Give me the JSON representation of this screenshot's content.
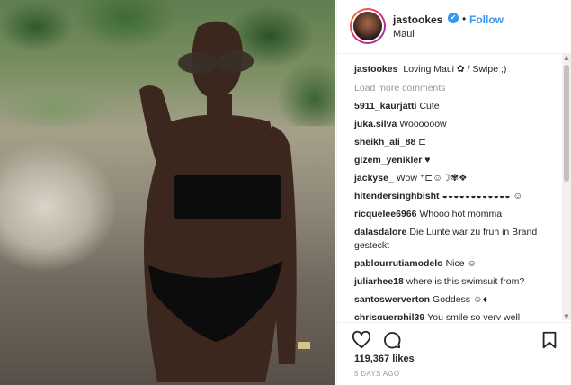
{
  "post": {
    "username": "jastookes",
    "verified_glyph": "✔",
    "separator": "•",
    "follow_label": "Follow",
    "location": "Maui"
  },
  "caption": {
    "username": "jastookes",
    "text": "Loving Maui ✿ / Swipe ;)"
  },
  "load_more": "Load more comments",
  "comments": [
    {
      "username": "5911_kaurjatti",
      "text": "Cute"
    },
    {
      "username": "juka.silva",
      "text": "Woooooow"
    },
    {
      "username": "sheikh_ali_88",
      "text": "⊏"
    },
    {
      "username": "gizem_yenikler",
      "text": "♥"
    },
    {
      "username": "jackyse_",
      "text": "Wow ⁺⊏☺☽✾❖"
    },
    {
      "username": "hitendersinghbisht",
      "text": "◒◒◒◒◒◒◒◒◒◒◒◒ ☺"
    },
    {
      "username": "ricquelee6966",
      "text": "Whooo hot momma"
    },
    {
      "username": "dalasdalore",
      "text": "Die Lunte war zu fruh in Brand gesteckt"
    },
    {
      "username": "pablourrutiamodelo",
      "text": "Nice ☺"
    },
    {
      "username": "juliarhee18",
      "text": "where is this swimsuit from?"
    },
    {
      "username": "santoswerverton",
      "text": "Goddess ☺♦"
    },
    {
      "username": "chrisguerphil39",
      "text": "You smile so very well"
    }
  ],
  "scrollbar": {
    "up": "▲",
    "down": "▼"
  },
  "likes": "119,367 likes",
  "timestamp": "5 DAYS AGO",
  "icons": [
    "heart-icon",
    "comment-icon",
    "bookmark-icon",
    "verified-icon"
  ],
  "colors": {
    "link": "#3897f0",
    "text": "#262626",
    "muted": "#999999",
    "border": "#efefef"
  }
}
